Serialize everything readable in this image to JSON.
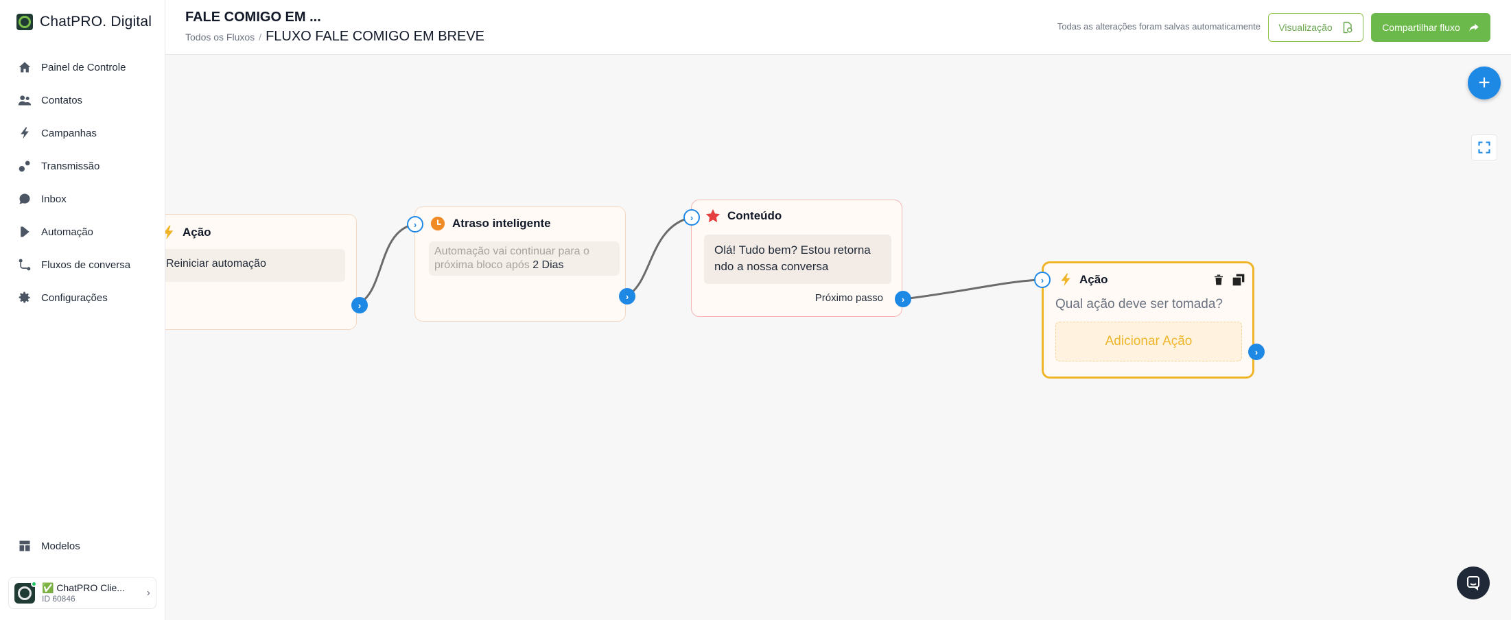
{
  "brand": {
    "name": "ChatPRO. Digital"
  },
  "sidebar": {
    "items": [
      {
        "label": "Painel de Controle",
        "icon": "home-icon"
      },
      {
        "label": "Contatos",
        "icon": "users-icon"
      },
      {
        "label": "Campanhas",
        "icon": "bolt-icon"
      },
      {
        "label": "Transmissão",
        "icon": "broadcast-icon"
      },
      {
        "label": "Inbox",
        "icon": "chat-icon"
      },
      {
        "label": "Automação",
        "icon": "play-icon"
      },
      {
        "label": "Fluxos de conversa",
        "icon": "flow-icon"
      },
      {
        "label": "Configurações",
        "icon": "gear-icon"
      }
    ],
    "bottom_item": {
      "label": "Modelos",
      "icon": "grid-icon"
    },
    "account": {
      "name": "✅ ChatPRO Clie...",
      "id": "ID 60846"
    }
  },
  "header": {
    "title": "FALE COMIGO EM ...",
    "breadcrumb_root": "Todos os Fluxos",
    "breadcrumb_sep": "/",
    "breadcrumb_current": "FLUXO FALE COMIGO EM BREVE",
    "save_status": "Todas as alterações foram salvas automaticamente",
    "preview_label": "Visualização",
    "share_label": "Compartilhar fluxo"
  },
  "nodes": {
    "action1": {
      "title": "Ação",
      "action_text": "Reiniciar automação"
    },
    "delay": {
      "title": "Atraso inteligente",
      "text": "Automação vai continuar para o próxima bloco após",
      "value": "2 Dias"
    },
    "content": {
      "title": "Conteúdo",
      "message": "Olá! Tudo bem? Estou retorna ndo a nossa conversa",
      "next_label": "Próximo passo"
    },
    "action2": {
      "title": "Ação",
      "question": "Qual ação deve ser tomada?",
      "add_label": "Adicionar Ação"
    }
  },
  "colors": {
    "accent": "#1e88e5",
    "brand_green": "#6bb84b",
    "action_border": "#f0b429"
  }
}
